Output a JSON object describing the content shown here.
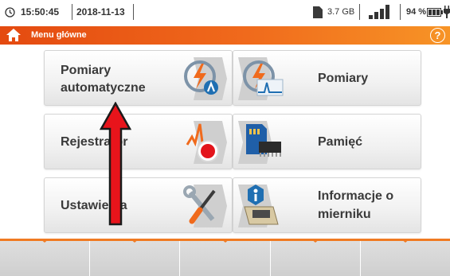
{
  "status_bar": {
    "time": "15:50:45",
    "date": "2018-11-13",
    "memory": "3.7 GB",
    "battery_percent": "94 %",
    "icons": [
      "clock-icon",
      "sd-card-icon",
      "signal-strength-icon",
      "battery-icon",
      "plug-icon"
    ]
  },
  "title_bar": {
    "title": "Menu główne",
    "icons": [
      "home-icon",
      "help-icon"
    ],
    "help_glyph": "?"
  },
  "menu": {
    "items": [
      {
        "line1": "Pomiary",
        "line2": "automatyczne",
        "icon": "auto-measurement-icon"
      },
      {
        "line1": "Pomiary",
        "line2": "",
        "icon": "measurement-icon"
      },
      {
        "line1": "Rejestrator",
        "line2": "",
        "icon": "recorder-icon"
      },
      {
        "line1": "Pamięć",
        "line2": "",
        "icon": "memory-card-icon"
      },
      {
        "line1": "Ustawienia",
        "line2": "",
        "icon": "settings-tools-icon"
      },
      {
        "line1": "Informacje o",
        "line2": "mierniku",
        "icon": "meter-info-icon"
      }
    ]
  },
  "softkeys": {
    "count": 5
  },
  "annotation": {
    "icon": "red-up-arrow",
    "color": "#e8141b"
  },
  "colors": {
    "accent": "#f06a1c",
    "title_gradient_start": "#e44a10",
    "title_gradient_end": "#f79426"
  }
}
